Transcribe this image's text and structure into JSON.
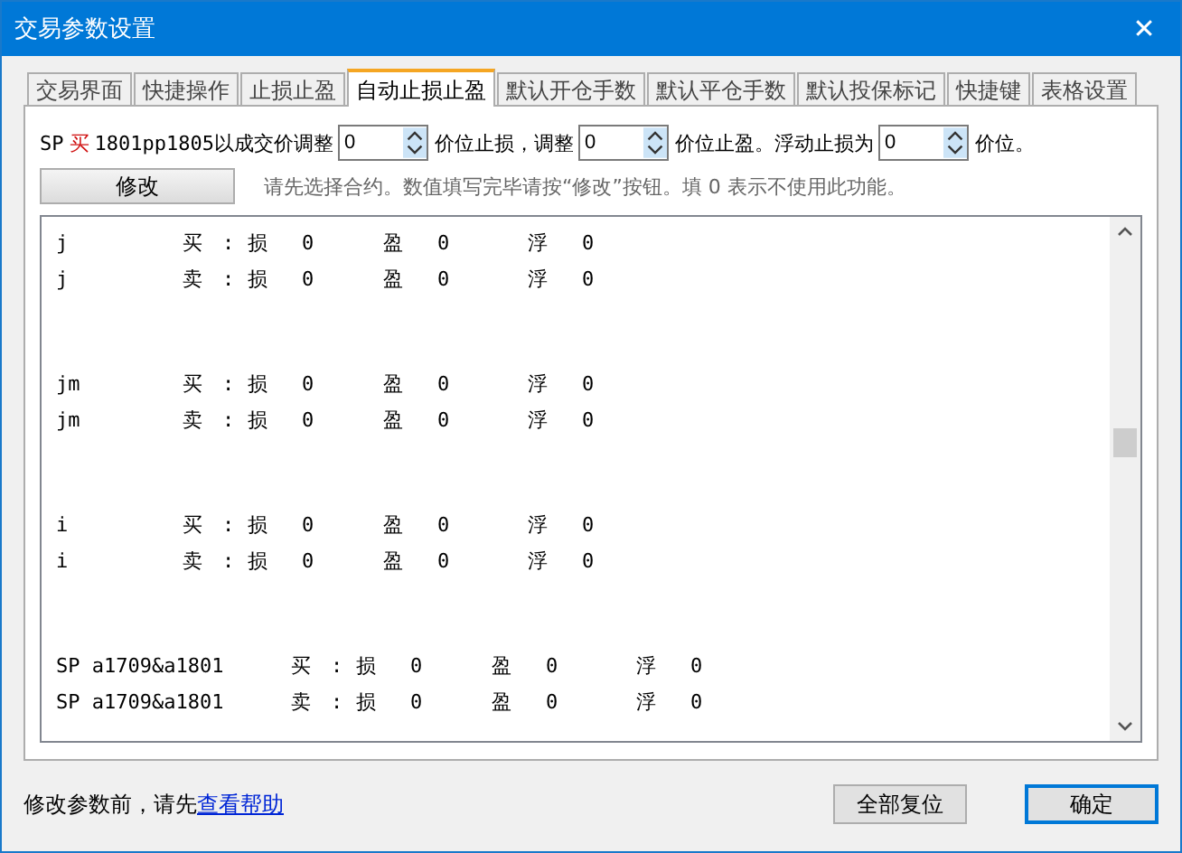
{
  "window": {
    "title": "交易参数设置",
    "close": "✕"
  },
  "tabs": [
    {
      "label": "交易界面",
      "selected": false
    },
    {
      "label": "快捷操作",
      "selected": false
    },
    {
      "label": "止损止盈",
      "selected": false
    },
    {
      "label": "自动止损止盈",
      "selected": true
    },
    {
      "label": "默认开仓手数",
      "selected": false
    },
    {
      "label": "默认平仓手数",
      "selected": false
    },
    {
      "label": "默认投保标记",
      "selected": false
    },
    {
      "label": "快捷键",
      "selected": false
    },
    {
      "label": "表格设置",
      "selected": false
    }
  ],
  "settings_line": [
    {
      "kind": "text",
      "text": "SP ",
      "emphasis": false
    },
    {
      "kind": "text",
      "text": "买",
      "emphasis": true
    },
    {
      "kind": "text",
      "text": "1801pp1805以成交价调整",
      "emphasis": false
    },
    {
      "kind": "spin",
      "value": "0"
    },
    {
      "kind": "text",
      "text": "价位止损，调整",
      "emphasis": false
    },
    {
      "kind": "spin",
      "value": "0"
    },
    {
      "kind": "text",
      "text": "价位止盈。浮动止损为",
      "emphasis": false
    },
    {
      "kind": "spin",
      "value": "0"
    },
    {
      "kind": "text",
      "text": "价位。",
      "emphasis": false
    }
  ],
  "modify_button": "修改",
  "hint": "请先选择合约。数值填写完毕请按“修改”按钮。填 0 表示不使用此功能。",
  "contract_groups": [
    {
      "rows": [
        [
          "j",
          "买",
          ":",
          "损",
          "0",
          "盈",
          "0",
          "浮",
          "0"
        ],
        [
          "j",
          "卖",
          ":",
          "损",
          "0",
          "盈",
          "0",
          "浮",
          "0"
        ]
      ]
    },
    {
      "rows": [
        [
          "jm",
          "买",
          ":",
          "损",
          "0",
          "盈",
          "0",
          "浮",
          "0"
        ],
        [
          "jm",
          "卖",
          ":",
          "损",
          "0",
          "盈",
          "0",
          "浮",
          "0"
        ]
      ]
    },
    {
      "rows": [
        [
          "i",
          "买",
          ":",
          "损",
          "0",
          "盈",
          "0",
          "浮",
          "0"
        ],
        [
          "i",
          "卖",
          ":",
          "损",
          "0",
          "盈",
          "0",
          "浮",
          "0"
        ]
      ]
    },
    {
      "rows": [
        [
          "SP a1709&a1801",
          "买",
          ":",
          "损",
          "0",
          "盈",
          "0",
          "浮",
          "0"
        ],
        [
          "SP a1709&a1801",
          "卖",
          ":",
          "损",
          "0",
          "盈",
          "0",
          "浮",
          "0"
        ]
      ]
    }
  ],
  "footer": {
    "text": "修改参数前，请先",
    "link": "查看帮助",
    "buttons": [
      {
        "label": "全部复位",
        "default": false
      },
      {
        "label": "确定",
        "default": true
      }
    ]
  }
}
